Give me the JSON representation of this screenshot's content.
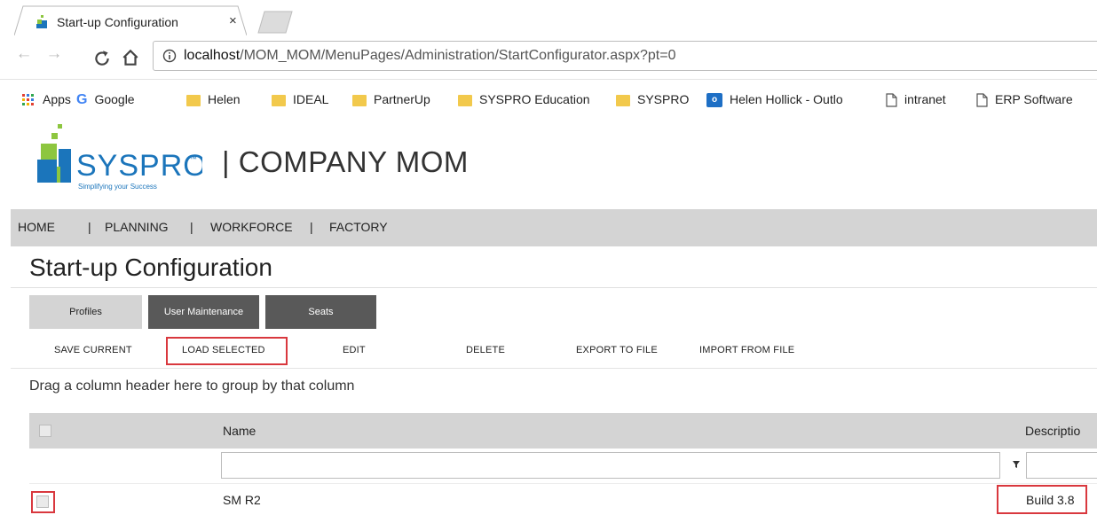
{
  "browser": {
    "tab_title": "Start-up Configuration",
    "tab_close": "×",
    "url_host": "localhost",
    "url_path": "/MOM_MOM/MenuPages/Administration/StartConfigurator.aspx?pt=0",
    "bookmarks": [
      {
        "label": "Apps",
        "icon": "apps-grid-icon"
      },
      {
        "label": "Google",
        "icon": "google-g-icon"
      },
      {
        "label": "Helen",
        "icon": "folder-icon"
      },
      {
        "label": "IDEAL",
        "icon": "folder-icon"
      },
      {
        "label": "PartnerUp",
        "icon": "folder-icon"
      },
      {
        "label": "SYSPRO Education",
        "icon": "folder-icon"
      },
      {
        "label": "SYSPRO",
        "icon": "folder-icon"
      },
      {
        "label": "Helen Hollick - Outlo",
        "icon": "outlook-icon"
      },
      {
        "label": "intranet",
        "icon": "page-icon"
      },
      {
        "label": "ERP Software",
        "icon": "page-icon"
      }
    ]
  },
  "app": {
    "logo_text": "SYSPRO",
    "logo_tm": "™",
    "logo_tagline": "Simplifying your Success",
    "company": "| COMPANY MOM",
    "menu": [
      "HOME",
      "PLANNING",
      "WORKFORCE",
      "FACTORY"
    ],
    "menu_sep": "|"
  },
  "page": {
    "title": "Start-up Configuration",
    "tab_buttons": [
      "Profiles",
      "User Maintenance",
      "Seats"
    ],
    "actions": [
      "SAVE CURRENT",
      "LOAD SELECTED",
      "EDIT",
      "DELETE",
      "EXPORT TO FILE",
      "IMPORT FROM FILE"
    ],
    "group_hint": "Drag a column header here to group by that column"
  },
  "grid": {
    "columns": {
      "name": "Name",
      "description": "Descriptio"
    },
    "rows": [
      {
        "name": "SM R2",
        "description": "Build 3.8"
      }
    ]
  },
  "colors": {
    "highlight": "#d9383e",
    "menu_bg": "#d4d4d4",
    "dark_button": "#595959",
    "logo_green": "#8dc63f",
    "logo_blue": "#1b75bb"
  }
}
